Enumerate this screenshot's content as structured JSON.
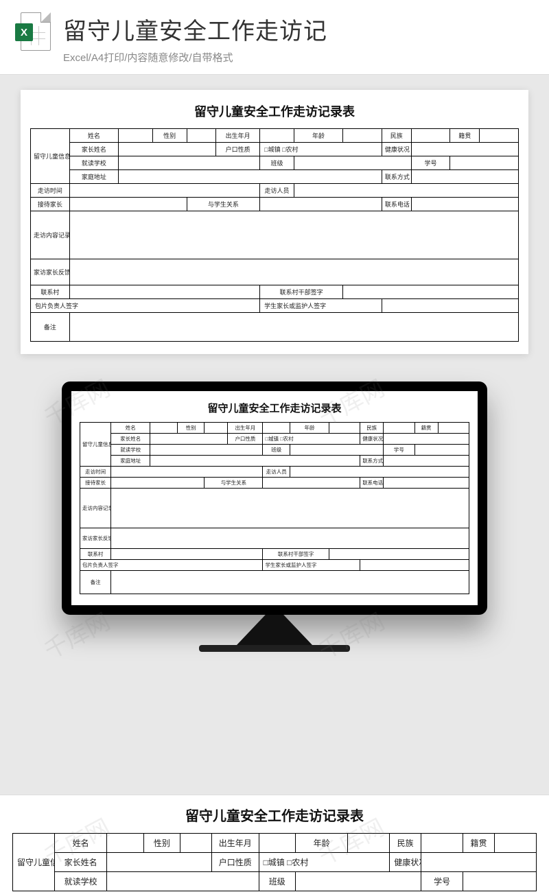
{
  "header": {
    "title": "留守儿童安全工作走访记",
    "subtitle": "Excel/A4打印/内容随意修改/自带格式",
    "icon_badge": "X"
  },
  "form": {
    "title": "留守儿童安全工作走访记录表",
    "labels": {
      "info_block": "留守儿童信息",
      "name": "姓名",
      "gender": "性别",
      "birth": "出生年月",
      "age": "年龄",
      "ethnic": "民族",
      "class_origin": "籍贯",
      "parent_name": "家长姓名",
      "hukou": "户口性质",
      "hukou_opts": "□城镇  □农村",
      "health": "健康状况",
      "school": "就读学校",
      "grade": "班级",
      "student_no": "学号",
      "address": "家庭地址",
      "contact": "联系方式",
      "visit_time": "走访时间",
      "visit_staff": "走访人员",
      "receiver": "接待家长",
      "relation": "与学生关系",
      "phone": "联系电话",
      "visit_content": "走访内容记录",
      "parent_feedback": "家访家长反馈事项",
      "contact_village": "联系村",
      "village_sign": "联系村干部签字",
      "area_sign": "包片负责人签字",
      "guardian_sign": "学生家长或监护人签字",
      "remarks": "备注"
    }
  },
  "watermark": "千库网"
}
